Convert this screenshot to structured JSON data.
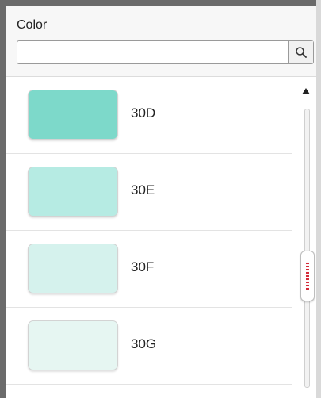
{
  "panel": {
    "label": "Color"
  },
  "search": {
    "value": "",
    "placeholder": ""
  },
  "colors": {
    "items": [
      {
        "label": "30D",
        "hex": "#7dd9ca"
      },
      {
        "label": "30E",
        "hex": "#b6ebe3"
      },
      {
        "label": "30F",
        "hex": "#d5f2ed"
      },
      {
        "label": "30G",
        "hex": "#e6f6f2"
      }
    ]
  },
  "icons": {
    "search": "search-icon",
    "scroll_up": "triangle-up-icon",
    "grip": "grip-dots-icon"
  }
}
